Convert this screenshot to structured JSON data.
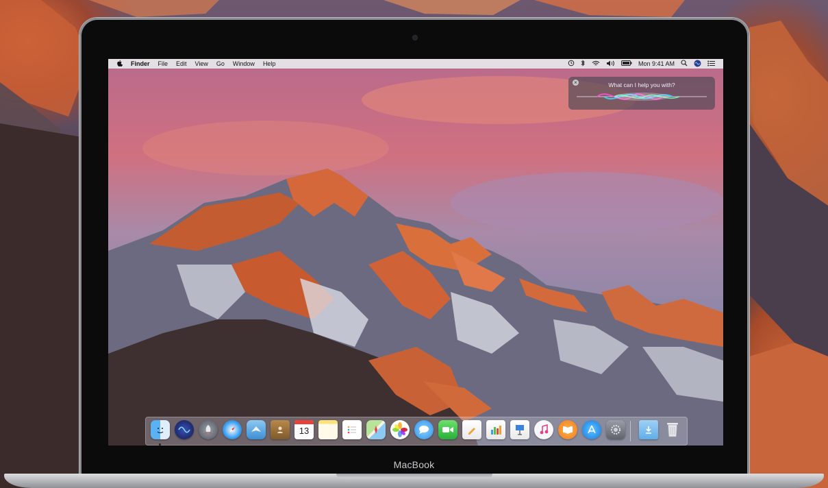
{
  "menubar": {
    "app_name": "Finder",
    "menus": [
      "File",
      "Edit",
      "View",
      "Go",
      "Window",
      "Help"
    ],
    "clock": "Mon 9:41 AM"
  },
  "siri": {
    "prompt": "What can I help you with?"
  },
  "dock": {
    "calendar_day": "13",
    "items": [
      "finder-icon",
      "siri-icon",
      "launchpad-icon",
      "safari-icon",
      "mail-icon",
      "contacts-icon",
      "calendar-icon",
      "notes-icon",
      "reminders-icon",
      "maps-icon",
      "photos-icon",
      "messages-icon",
      "facetime-icon",
      "pages-icon",
      "numbers-icon",
      "keynote-icon",
      "itunes-icon",
      "ibooks-icon",
      "app-store-icon",
      "system-preferences-icon",
      "downloads-folder-icon",
      "trash-icon"
    ]
  },
  "device": {
    "label": "MacBook"
  }
}
